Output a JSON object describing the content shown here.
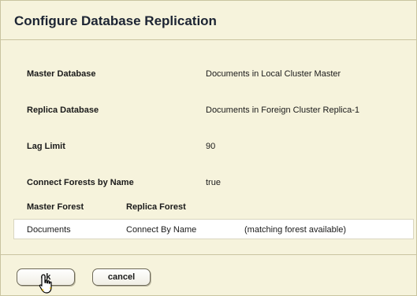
{
  "dialog": {
    "title": "Configure Database Replication"
  },
  "fields": [
    {
      "label": "Master Database",
      "value": "Documents in Local Cluster Master"
    },
    {
      "label": "Replica Database",
      "value": "Documents in Foreign Cluster Replica-1"
    },
    {
      "label": "Lag Limit",
      "value": "90"
    },
    {
      "label": "Connect Forests by Name",
      "value": "true"
    }
  ],
  "forest_table": {
    "headers": [
      "Master Forest",
      "Replica Forest"
    ],
    "rows": [
      {
        "master": "Documents",
        "replica": "Connect By Name",
        "status": "(matching forest available)"
      }
    ]
  },
  "buttons": {
    "ok_label": "ok",
    "cancel_label": "cancel"
  },
  "icons": {
    "cursor": "hand-pointer-icon"
  }
}
